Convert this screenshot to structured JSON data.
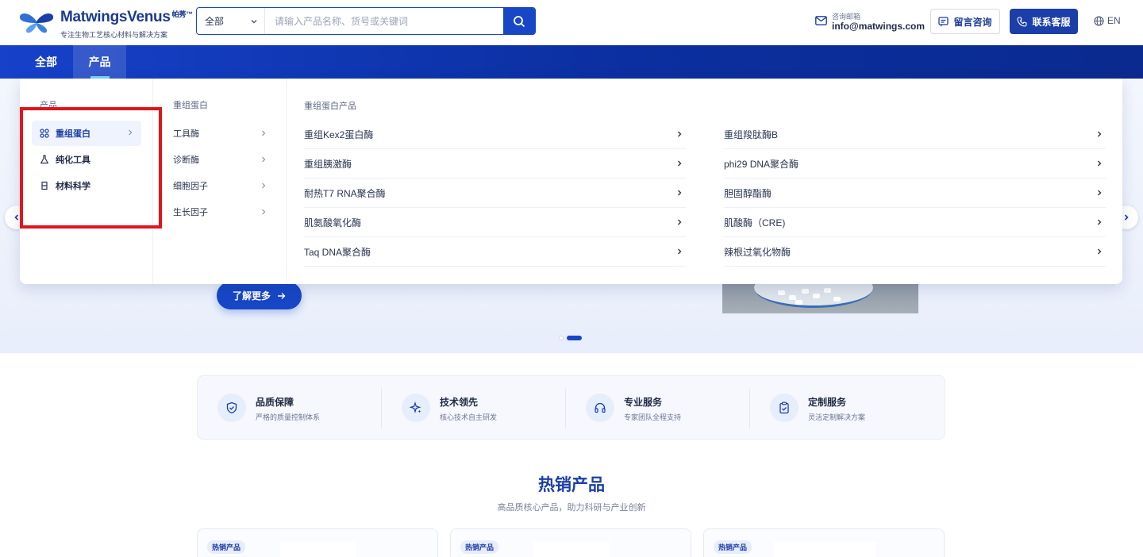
{
  "brand": {
    "name": "MatwingsVenus",
    "name_suffix": "帕莠™",
    "tagline": "专注生物工艺核心材料与解决方案"
  },
  "search": {
    "category": "全部",
    "placeholder": "请输入产品名称、货号或关键词"
  },
  "contact": {
    "label": "咨询邮箱",
    "email": "info@matwings.com"
  },
  "header_buttons": {
    "message": "留言咨询",
    "service": "联系客服",
    "language": "EN"
  },
  "nav": {
    "items": [
      "全部",
      "产品"
    ],
    "active": "产品"
  },
  "mega_menu": {
    "col1_title": "产品",
    "categories": [
      {
        "label": "重组蛋白",
        "icon": "molecule-icon",
        "active": true
      },
      {
        "label": "纯化工具",
        "icon": "flask-icon",
        "active": false
      },
      {
        "label": "材料科学",
        "icon": "beaker-icon",
        "active": false
      }
    ],
    "col2_title": "重组蛋白",
    "subcategories": [
      "工具酶",
      "诊断酶",
      "细胞因子",
      "生长因子"
    ],
    "col3_title": "重组蛋白产品",
    "products_left": [
      "重组Kex2蛋白酶",
      "重组胰激酶",
      "耐热T7 RNA聚合酶",
      "肌氨酸氧化酶",
      "Taq DNA聚合酶"
    ],
    "products_right": [
      "重组羧肽酶B",
      "phi29 DNA聚合酶",
      "胆固醇酯酶",
      "肌酸酶（CRE)",
      "辣根过氧化物酶"
    ]
  },
  "hero": {
    "more_button": "了解更多",
    "slides": 2,
    "active_slide": 2
  },
  "features": [
    {
      "title": "品质保障",
      "desc": "严格的质量控制体系",
      "icon": "shield-check-icon"
    },
    {
      "title": "技术领先",
      "desc": "核心技术自主研发",
      "icon": "sparkle-icon"
    },
    {
      "title": "专业服务",
      "desc": "专家团队全程支持",
      "icon": "headset-icon"
    },
    {
      "title": "定制服务",
      "desc": "灵活定制解决方案",
      "icon": "clipboard-check-icon"
    }
  ],
  "hot_products": {
    "title": "热销产品",
    "subtitle": "高品质核心产品，助力科研与产业创新",
    "badges": [
      "热销产品",
      "热销产品",
      "热销产品"
    ]
  },
  "colors": {
    "primary": "#1747c6",
    "nav_dark": "#0a2a8f",
    "highlight": "#e0151b"
  }
}
